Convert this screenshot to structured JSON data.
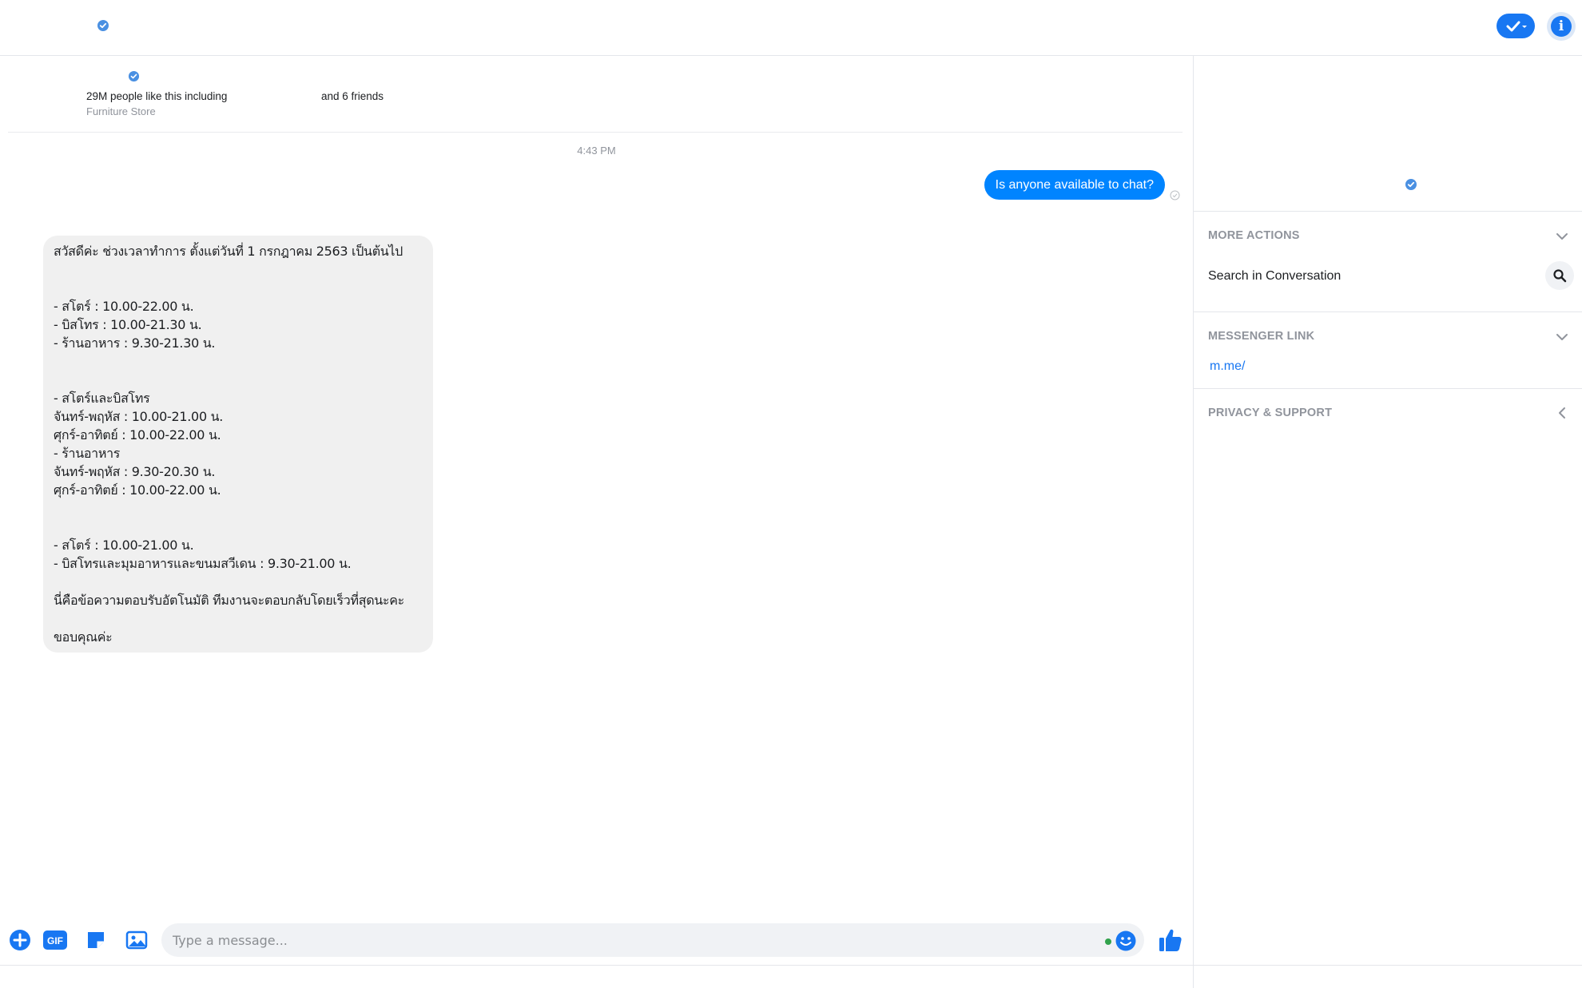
{
  "header": {
    "verified_icon": "verified-badge-icon",
    "toggle_icon": "checkmark-dropdown-icon",
    "info_icon": "info-icon",
    "info_glyph": "i",
    "accent_color": "#1877f2"
  },
  "page_info": {
    "likes_text": "29M people like this including",
    "friends_text": "and 6 friends",
    "category": "Furniture Store"
  },
  "conversation": {
    "timestamp": "4:43 PM",
    "outgoing": {
      "text": "Is anyone available to chat?",
      "color": "#0084ff"
    },
    "incoming": {
      "lines": [
        "สวัสดีค่ะ ช่วงเวลาทำการ ตั้งแต่วันที่ 1 กรกฎาคม 2563 เป็นต้นไป",
        "",
        "",
        "- สโตร์ : 10.00-22.00 น.",
        "- บิสโทร : 10.00-21.30 น.",
        "- ร้านอาหาร : 9.30-21.30 น.",
        "",
        "",
        "- สโตร์และบิสโทร",
        "จันทร์-พฤหัส : 10.00-21.00 น.",
        "ศุกร์-อาทิตย์ : 10.00-22.00 น.",
        "- ร้านอาหาร",
        "จันทร์-พฤหัส : 9.30-20.30 น.",
        "ศุกร์-อาทิตย์ : 10.00-22.00 น.",
        "",
        "",
        "- สโตร์ : 10.00-21.00 น.",
        "- บิสโทรและมุมอาหารและขนมสวีเดน : 9.30-21.00 น.",
        "",
        "นี่คือข้อความตอบรับอัตโนมัติ ทีมงานจะตอบกลับโดยเร็วที่สุดนะคะ",
        "",
        "ขอบคุณค่ะ"
      ]
    }
  },
  "composer": {
    "placeholder": "Type a message...",
    "gif_label": "GIF",
    "buttons": [
      "plus-icon",
      "gif-icon",
      "sticker-icon",
      "image-icon",
      "emoji-icon",
      "thumbs-up-icon"
    ]
  },
  "sidebar": {
    "more_actions": {
      "title": "MORE ACTIONS",
      "search_label": "Search in Conversation"
    },
    "messenger_link": {
      "title": "MESSENGER LINK",
      "link": "m.me/"
    },
    "privacy": {
      "title": "PRIVACY & SUPPORT"
    }
  }
}
